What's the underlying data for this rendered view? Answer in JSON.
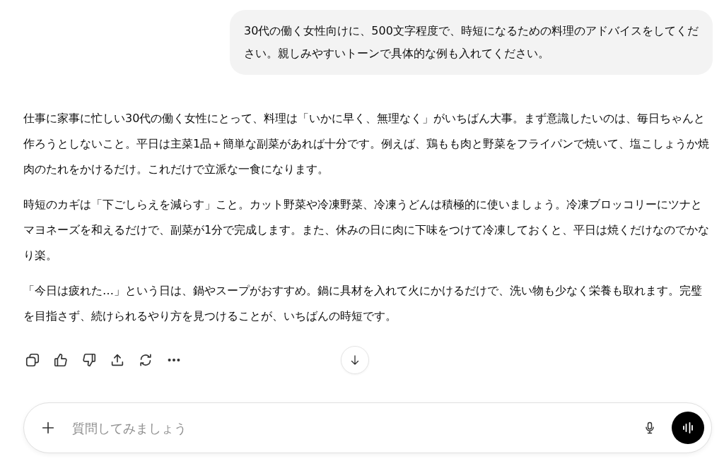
{
  "user_message": "30代の働く女性向けに、500文字程度で、時短になるための料理のアドバイスをしてください。親しみやすいトーンで具体的な例も入れてください。",
  "response": {
    "paragraphs": [
      "仕事に家事に忙しい30代の働く女性にとって、料理は「いかに早く、無理なく」がいちばん大事。まず意識したいのは、毎日ちゃんと作ろうとしないこと。平日は主菜1品＋簡単な副菜があれば十分です。例えば、鶏もも肉と野菜をフライパンで焼いて、塩こしょうか焼肉のたれをかけるだけ。これだけで立派な一食になります。",
      "時短のカギは「下ごしらえを減らす」こと。カット野菜や冷凍野菜、冷凍うどんは積極的に使いましょう。冷凍ブロッコリーにツナとマヨネーズを和えるだけで、副菜が1分で完成します。また、休みの日に肉に下味をつけて冷凍しておくと、平日は焼くだけなのでかなり楽。",
      "「今日は疲れた…」という日は、鍋やスープがおすすめ。鍋に具材を入れて火にかけるだけで、洗い物も少なく栄養も取れます。完璧を目指さず、続けられるやり方を見つけることが、いちばんの時短です。"
    ]
  },
  "composer": {
    "placeholder": "質問してみましょう"
  }
}
